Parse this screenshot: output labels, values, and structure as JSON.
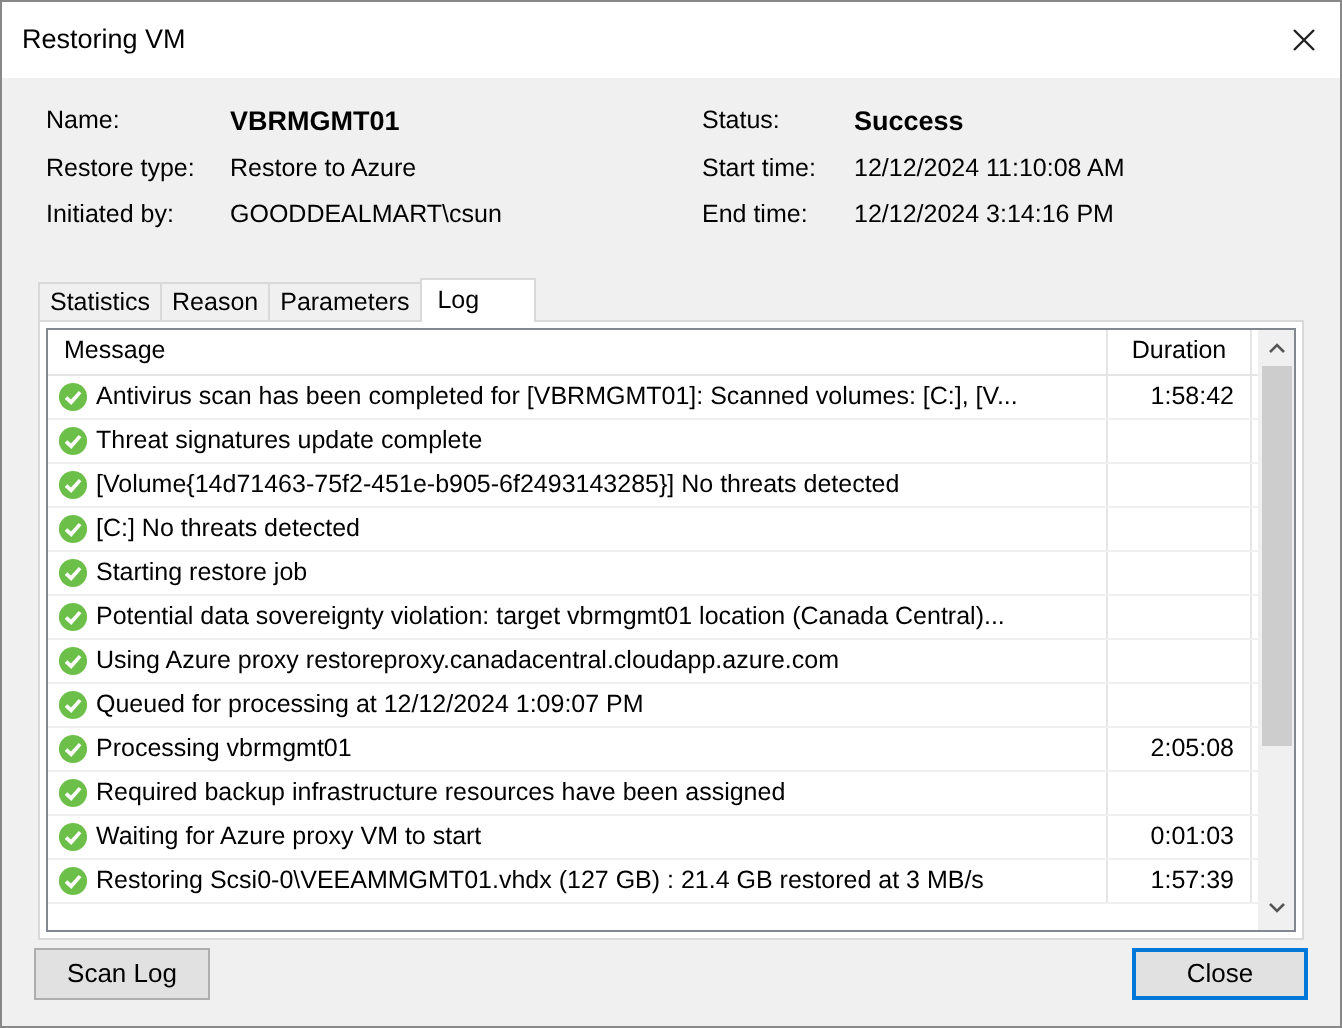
{
  "window": {
    "title": "Restoring VM"
  },
  "details_left": [
    {
      "label": "Name:",
      "value": "VBRMGMT01",
      "bold": true
    },
    {
      "label": "Restore type:",
      "value": "Restore to Azure",
      "bold": false
    },
    {
      "label": "Initiated by:",
      "value": "GOODDEALMART\\csun",
      "bold": false
    }
  ],
  "details_right": [
    {
      "label": "Status:",
      "value": "Success",
      "bold": true
    },
    {
      "label": "Start time:",
      "value": "12/12/2024 11:10:08 AM",
      "bold": false
    },
    {
      "label": "End time:",
      "value": "12/12/2024 3:14:16 PM",
      "bold": false
    }
  ],
  "tabs": [
    {
      "label": "Statistics",
      "selected": false
    },
    {
      "label": "Reason",
      "selected": false
    },
    {
      "label": "Parameters",
      "selected": false
    },
    {
      "label": "Log",
      "selected": true
    }
  ],
  "log": {
    "columns": [
      "Message",
      "Duration"
    ],
    "rows": [
      {
        "kind": "success",
        "message": "Antivirus scan has been completed for [VBRMGMT01]: Scanned volumes: [C:], [V...",
        "duration": "1:58:42"
      },
      {
        "kind": "success",
        "message": "Threat signatures update complete"
      },
      {
        "kind": "success",
        "message": "[Volume{14d71463-75f2-451e-b905-6f2493143285}] No threats detected"
      },
      {
        "kind": "success",
        "message": "[C:] No threats detected"
      },
      {
        "kind": "success",
        "message": "Starting restore job"
      },
      {
        "kind": "success",
        "message": "Potential data sovereignty violation: target vbrmgmt01 location (Canada Central)..."
      },
      {
        "kind": "success",
        "message": "Using Azure proxy restoreproxy.canadacentral.cloudapp.azure.com"
      },
      {
        "kind": "success",
        "message": "Queued for processing at 12/12/2024 1:09:07 PM"
      },
      {
        "kind": "success",
        "message": "Processing vbrmgmt01",
        "duration": "2:05:08"
      },
      {
        "kind": "success",
        "message": "Required backup infrastructure resources have been assigned"
      },
      {
        "kind": "success",
        "message": "Waiting for Azure proxy VM to start",
        "duration": "0:01:03"
      },
      {
        "kind": "success",
        "message": "Restoring Scsi0-0\\VEEAMMGMT01.vhdx (127 GB) : 21.4 GB restored at 3 MB/s",
        "duration": "1:57:39"
      }
    ]
  },
  "buttons": [
    {
      "label": "Scan Log",
      "default": false
    },
    {
      "label": "Close",
      "default": true
    }
  ]
}
